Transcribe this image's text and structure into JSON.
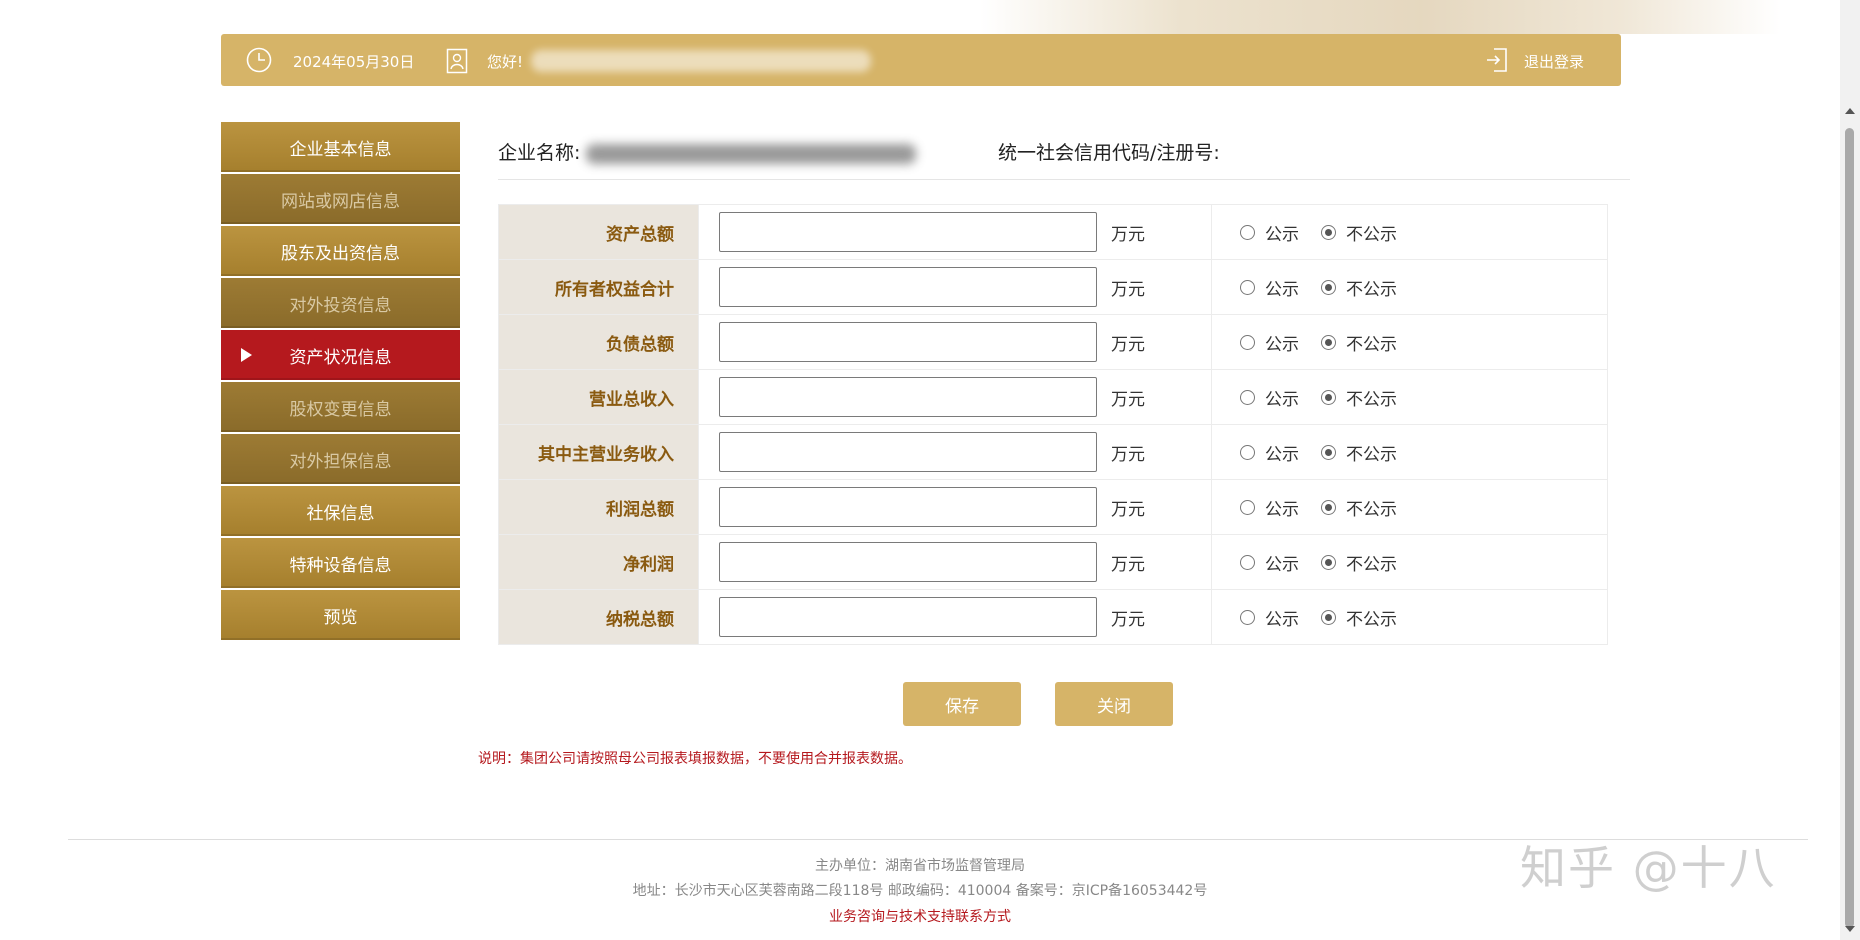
{
  "topbar": {
    "date": "2024年05月30日",
    "greeting": "您好!",
    "logout": "退出登录"
  },
  "sidebar": {
    "items": [
      {
        "label": "企业基本信息"
      },
      {
        "label": "网站或网店信息"
      },
      {
        "label": "股东及出资信息"
      },
      {
        "label": "对外投资信息"
      },
      {
        "label": "资产状况信息"
      },
      {
        "label": "股权变更信息"
      },
      {
        "label": "对外担保信息"
      },
      {
        "label": "社保信息"
      },
      {
        "label": "特种设备信息"
      },
      {
        "label": "预览"
      }
    ],
    "active_index": 4
  },
  "info": {
    "company_label": "企业名称:",
    "credit_code_label": "统一社会信用代码/注册号:"
  },
  "form": {
    "unit": "万元",
    "public_label": "公示",
    "private_label": "不公示",
    "rows": [
      {
        "label": "资产总额",
        "value": "",
        "public": false
      },
      {
        "label": "所有者权益合计",
        "value": "",
        "public": false
      },
      {
        "label": "负债总额",
        "value": "",
        "public": false
      },
      {
        "label": "营业总收入",
        "value": "",
        "public": false
      },
      {
        "label": "其中主营业务收入",
        "value": "",
        "public": false
      },
      {
        "label": "利润总额",
        "value": "",
        "public": false
      },
      {
        "label": "净利润",
        "value": "",
        "public": false
      },
      {
        "label": "纳税总额",
        "value": "",
        "public": false
      }
    ]
  },
  "buttons": {
    "save": "保存",
    "close": "关闭"
  },
  "note": "说明：集团公司请按照母公司报表填报数据，不要使用合并报表数据。",
  "footer": {
    "sponsor": "主办单位：湖南省市场监督管理局",
    "address": "地址：长沙市天心区芙蓉南路二段118号 邮政编码：410004 备案号：京ICP备16053442号",
    "support": "业务咨询与技术支持联系方式"
  },
  "watermark": "知乎 @十八",
  "colors": {
    "gold": "#d6b468",
    "sidebar": "#a57f2d",
    "active": "#b5191e",
    "label_text": "#8a5a10"
  }
}
